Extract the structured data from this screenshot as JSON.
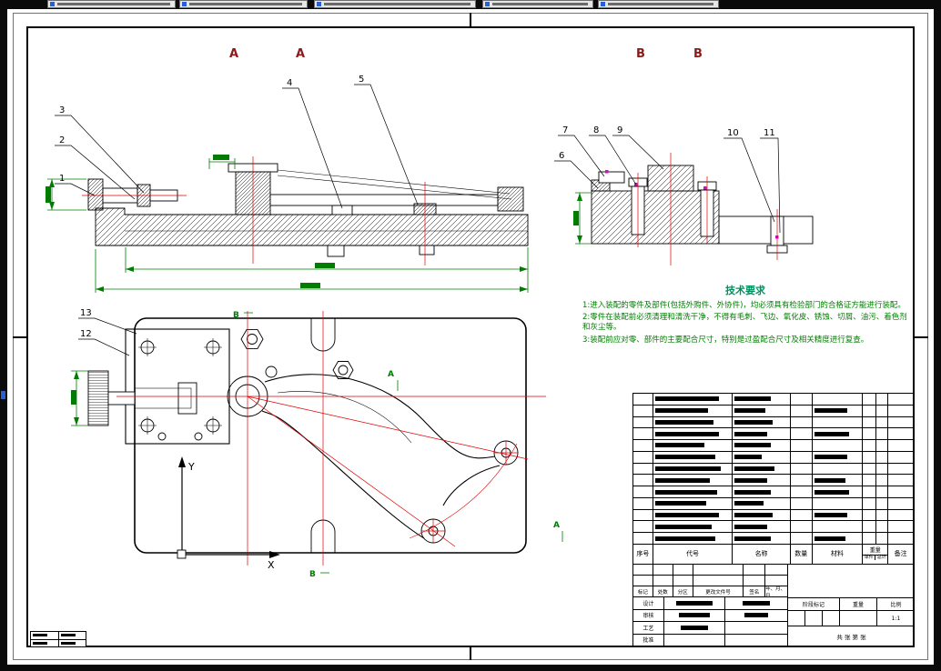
{
  "window": {
    "tabs": [
      {
        "icon": "drawing-file-icon"
      },
      {
        "icon": "drawing-file-icon"
      },
      {
        "icon": "drawing-file-icon"
      },
      {
        "icon": "drawing-file-icon"
      },
      {
        "icon": "drawing-file-icon"
      }
    ]
  },
  "sheet": {
    "section_labels": [
      "A",
      "A",
      "B",
      "B"
    ],
    "balloons": [
      "1",
      "2",
      "3",
      "4",
      "5",
      "6",
      "7",
      "8",
      "9",
      "10",
      "11",
      "12",
      "13"
    ],
    "cut_letters": [
      "A",
      "A",
      "B",
      "B"
    ],
    "axis": {
      "x": "X",
      "y": "Y"
    }
  },
  "tech_requirements": {
    "title": "技术要求",
    "items": [
      "1:进入装配的零件及部件(包括外购件、外协件)，均必须具有检验部门的合格证方能进行装配。",
      "2:零件在装配前必须清理和清洗干净，不得有毛刺、飞边、氧化皮、锈蚀、切屑、油污、着色剂和灰尘等。",
      "3:装配前应对零、部件的主要配合尺寸，特别是过盈配合尺寸及相关精度进行复查。"
    ]
  },
  "bom": {
    "headers": [
      "序号",
      "代号",
      "名称",
      "数量",
      "材料",
      "重量",
      "备注"
    ],
    "weight_sub": [
      "单件",
      "总计"
    ],
    "rows": [
      {
        "c": 70,
        "n": 40,
        "m": 0
      },
      {
        "c": 58,
        "n": 34,
        "m": 36
      },
      {
        "c": 64,
        "n": 42,
        "m": 0
      },
      {
        "c": 70,
        "n": 36,
        "m": 38
      },
      {
        "c": 54,
        "n": 40,
        "m": 0
      },
      {
        "c": 66,
        "n": 30,
        "m": 36
      },
      {
        "c": 72,
        "n": 44,
        "m": 0
      },
      {
        "c": 60,
        "n": 36,
        "m": 34
      },
      {
        "c": 68,
        "n": 40,
        "m": 38
      },
      {
        "c": 56,
        "n": 32,
        "m": 0
      },
      {
        "c": 70,
        "n": 42,
        "m": 36
      },
      {
        "c": 62,
        "n": 36,
        "m": 0
      },
      {
        "c": 66,
        "n": 40,
        "m": 34
      }
    ]
  },
  "title_block": {
    "rev_headers": [
      "标记",
      "处数",
      "分区",
      "更改文件号",
      "签名",
      "年、月、日"
    ],
    "sign_rows": [
      {
        "label": "设计",
        "bars": [
          40,
          30
        ]
      },
      {
        "label": "审核",
        "bars": [
          34,
          26
        ]
      },
      {
        "label": "工艺",
        "bars": [
          30,
          0
        ]
      },
      {
        "label": "批准",
        "bars": [
          0,
          0
        ]
      }
    ],
    "stage_label": "阶段标记",
    "weight_label": "重量",
    "scale_label": "比例",
    "scale_value": "1:1",
    "sheet_info": "共  张  第  张"
  },
  "colors": {
    "background": "#0a0a0a",
    "paper": "#ffffff",
    "line": "#000000",
    "dimension": "#007d00",
    "centerline": "#e00000",
    "highlight": "#e000e0",
    "section_label": "#8b1a1a"
  }
}
